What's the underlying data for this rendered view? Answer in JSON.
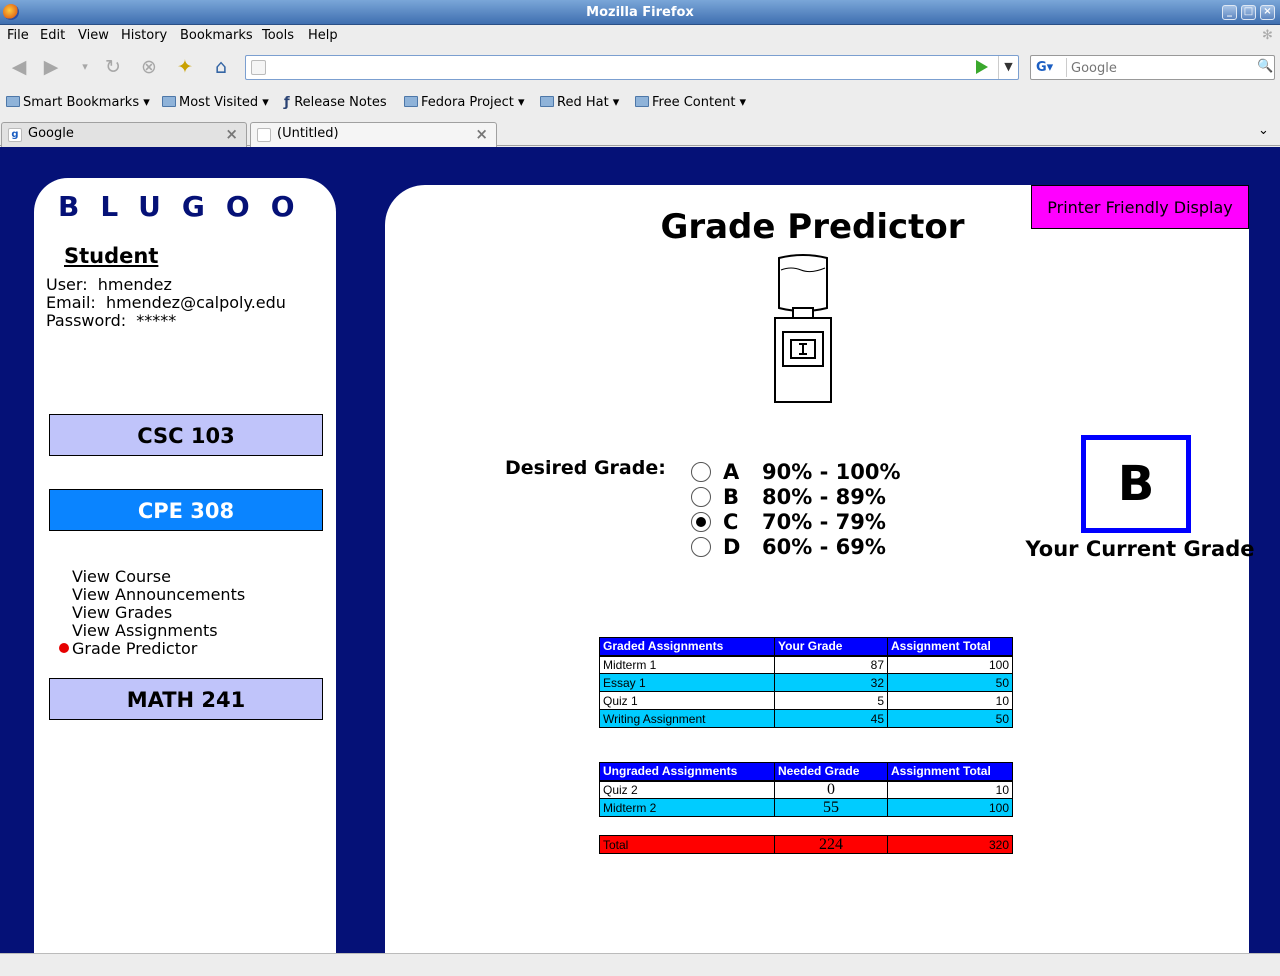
{
  "window": {
    "title": "Mozilla Firefox"
  },
  "menu": [
    "File",
    "Edit",
    "View",
    "History",
    "Bookmarks",
    "Tools",
    "Help"
  ],
  "toolbar": {
    "url_value": "",
    "search_placeholder": "Google",
    "search_engine": "G"
  },
  "bookmarks": [
    "Smart Bookmarks",
    "Most Visited",
    "Release Notes",
    "Fedora Project",
    "Red Hat",
    "Free Content"
  ],
  "tabs": [
    {
      "label": "Google"
    },
    {
      "label": "(Untitled)"
    }
  ],
  "sidebar": {
    "logo": "BLUGOO",
    "student_heading": "Student",
    "user_label": "User:",
    "user_value": "hmendez",
    "email_label": "Email:",
    "email_value": "hmendez@calpoly.edu",
    "password_label": "Password:",
    "password_value": "*****",
    "courses": [
      "CSC 103",
      "CPE 308",
      "MATH 241"
    ],
    "links": [
      "View Course",
      "View Announcements",
      "View Grades",
      "View Assignments",
      "Grade Predictor"
    ],
    "active_link": "Grade Predictor"
  },
  "main": {
    "print_button": "Printer Friendly Display",
    "title": "Grade Predictor",
    "desired_label": "Desired Grade:",
    "grades": [
      {
        "letter": "A",
        "range": "90% - 100%",
        "selected": false
      },
      {
        "letter": "B",
        "range": "80% - 89%",
        "selected": false
      },
      {
        "letter": "C",
        "range": "70% - 79%",
        "selected": true
      },
      {
        "letter": "D",
        "range": "60% - 69%",
        "selected": false
      }
    ],
    "current_grade": "B",
    "current_grade_label": "Your Current Grade",
    "graded": {
      "headers": [
        "Graded Assignments",
        "Your Grade",
        "Assignment Total"
      ],
      "rows": [
        [
          "Midterm 1",
          "87",
          "100"
        ],
        [
          "Essay 1",
          "32",
          "50"
        ],
        [
          "Quiz 1",
          "5",
          "10"
        ],
        [
          "Writing Assignment",
          "45",
          "50"
        ]
      ]
    },
    "ungraded": {
      "headers": [
        "Ungraded Assignments",
        "Needed Grade",
        "Assignment Total"
      ],
      "rows": [
        [
          "Quiz 2",
          "0",
          "10"
        ],
        [
          "Midterm 2",
          "55",
          "100"
        ]
      ]
    },
    "total": {
      "label": "Total",
      "value": "224",
      "max": "320"
    }
  },
  "colors": {
    "page_bg": "#051177",
    "selected_course": "#0a84ff",
    "course": "#c0c4fa",
    "print_btn": "#ff00ff",
    "table_header": "#0000ff",
    "table_alt": "#00ccff",
    "total_row": "#ff0000"
  }
}
